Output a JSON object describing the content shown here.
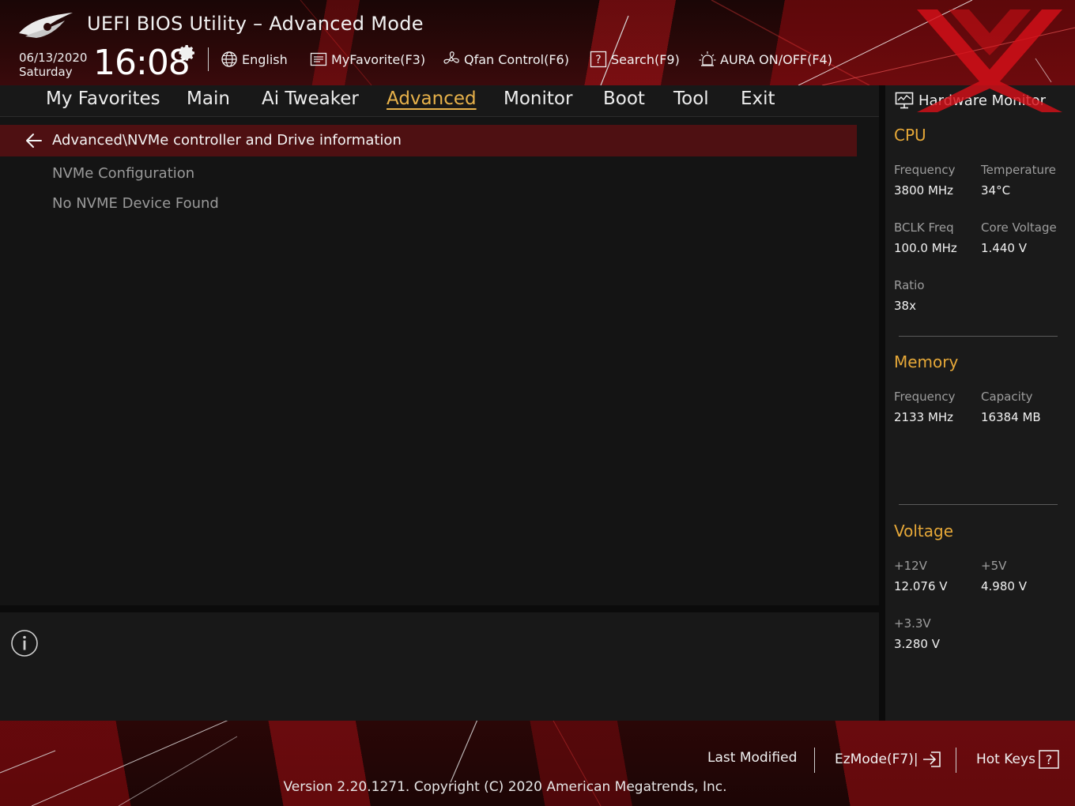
{
  "header": {
    "title": "UEFI BIOS Utility – Advanced Mode",
    "date": "06/13/2020",
    "day": "Saturday",
    "time": "16:08",
    "tools": {
      "language": "English",
      "myfavorite": "MyFavorite(F3)",
      "qfan": "Qfan Control(F6)",
      "search": "Search(F9)",
      "aura": "AURA ON/OFF(F4)"
    }
  },
  "nav": {
    "tabs": [
      "My Favorites",
      "Main",
      "Ai Tweaker",
      "Advanced",
      "Monitor",
      "Boot",
      "Tool",
      "Exit"
    ],
    "active": "Advanced"
  },
  "main": {
    "breadcrumb": "Advanced\\NVMe controller and Drive information",
    "items": [
      "NVMe Configuration",
      "No NVME Device Found"
    ]
  },
  "hw_monitor": {
    "title": "Hardware Monitor",
    "cpu": {
      "heading": "CPU",
      "frequency_label": "Frequency",
      "frequency_value": "3800 MHz",
      "temperature_label": "Temperature",
      "temperature_value": "34°C",
      "bclk_label": "BCLK Freq",
      "bclk_value": "100.0 MHz",
      "core_voltage_label": "Core Voltage",
      "core_voltage_value": "1.440 V",
      "ratio_label": "Ratio",
      "ratio_value": "38x"
    },
    "memory": {
      "heading": "Memory",
      "frequency_label": "Frequency",
      "frequency_value": "2133 MHz",
      "capacity_label": "Capacity",
      "capacity_value": "16384 MB"
    },
    "voltage": {
      "heading": "Voltage",
      "v12_label": "+12V",
      "v12_value": "12.076 V",
      "v5_label": "+5V",
      "v5_value": "4.980 V",
      "v33_label": "+3.3V",
      "v33_value": "3.280 V"
    }
  },
  "footer": {
    "last_modified": "Last Modified",
    "ezmode": "EzMode(F7)|",
    "hotkeys": "Hot Keys",
    "version": "Version 2.20.1271. Copyright (C) 2020 American Megatrends, Inc."
  },
  "colors": {
    "accent": "#e8b24a",
    "section_heading": "#e6a838",
    "breadcrumb_bg": "#4e1012",
    "watermark": "#d41018"
  }
}
